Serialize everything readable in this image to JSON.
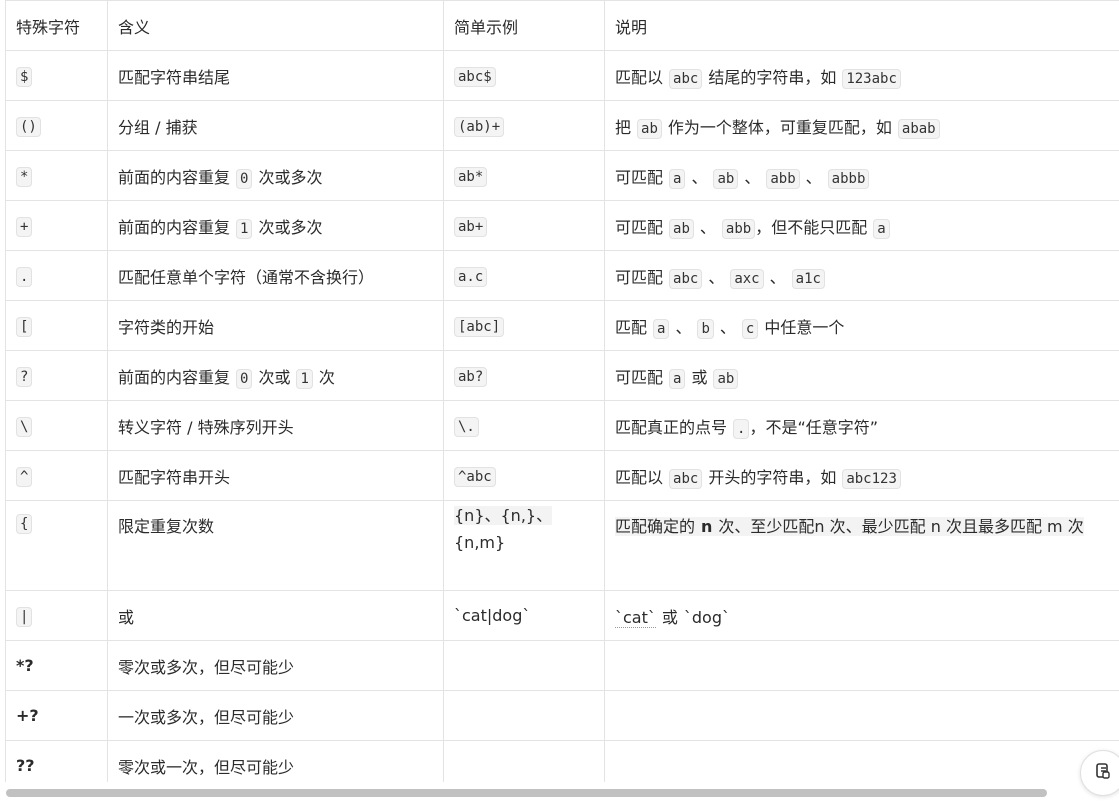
{
  "table": {
    "headers": [
      "特殊字符",
      "含义",
      "简单示例",
      "说明"
    ],
    "rows": [
      {
        "char": "$",
        "meaning": "匹配字符串结尾",
        "example": "abc$",
        "desc": {
          "t1": "匹配以",
          "c1": "abc",
          "t2": "结尾的字符串，如",
          "c2": "123abc"
        }
      },
      {
        "char": "()",
        "meaning": "分组 / 捕获",
        "example": "(ab)+",
        "desc": {
          "t1": "把",
          "c1": "ab",
          "t2": "作为一个整体，可重复匹配，如",
          "c2": "abab"
        }
      },
      {
        "char": "*",
        "meaning": {
          "t1": "前面的内容重复",
          "c1": "0",
          "t2": "次或多次"
        },
        "example": "ab*",
        "desc": {
          "t1": "可匹配",
          "c1": "a",
          "s1": "、",
          "c2": "ab",
          "s2": "、",
          "c3": "abb",
          "s3": "、",
          "c4": "abbb"
        }
      },
      {
        "char": "+",
        "meaning": {
          "t1": "前面的内容重复",
          "c1": "1",
          "t2": "次或多次"
        },
        "example": "ab+",
        "desc": {
          "t1": "可匹配",
          "c1": "ab",
          "s1": "、",
          "c2": "abb",
          "t2": "，但不能只匹配",
          "c3": "a"
        }
      },
      {
        "char": ".",
        "meaning": "匹配任意单个字符（通常不含换行）",
        "example": "a.c",
        "desc": {
          "t1": "可匹配",
          "c1": "abc",
          "s1": "、",
          "c2": "axc",
          "s2": "、",
          "c3": "a1c"
        }
      },
      {
        "char": "[",
        "meaning": "字符类的开始",
        "example": "[abc]",
        "desc": {
          "t1": "匹配",
          "c1": "a",
          "s1": "、",
          "c2": "b",
          "s2": "、",
          "c3": "c",
          "t2": "中任意一个"
        }
      },
      {
        "char": "?",
        "meaning": {
          "t1": "前面的内容重复",
          "c1": "0",
          "t2": "次或",
          "c2": "1",
          "t3": "次"
        },
        "example": "ab?",
        "desc": {
          "t1": "可匹配",
          "c1": "a",
          "t2": "或",
          "c2": "ab"
        }
      },
      {
        "char": "\\",
        "meaning": "转义字符 / 特殊序列开头",
        "example": "\\.",
        "desc": {
          "t1": "匹配真正的点号",
          "c1": ".",
          "t2": "，不是“任意字符”"
        }
      },
      {
        "char": "^",
        "meaning": "匹配字符串开头",
        "example": "^abc",
        "desc": {
          "t1": "匹配以",
          "c1": "abc",
          "t2": "开头的字符串，如",
          "c2": "abc123"
        }
      },
      {
        "char": "{",
        "meaning": "限定重复次数",
        "example": {
          "line1": "{n}、{n,}、",
          "line2": "{n,m}"
        },
        "desc": {
          "t1": "匹配确定的",
          "b1": "n",
          "t2": "次、至少匹配n 次、最少匹配 n 次且最多匹配 m 次"
        }
      },
      {
        "char": "|",
        "meaning": "或",
        "example": "`cat|dog`",
        "desc": {
          "q1": "`cat`",
          "t1": "或",
          "q2": "`dog`"
        }
      },
      {
        "char": "*?",
        "meaning": "零次或多次，但尽可能少",
        "example": "",
        "desc": ""
      },
      {
        "char": "+?",
        "meaning": "一次或多次，但尽可能少",
        "example": "",
        "desc": ""
      },
      {
        "char": "??",
        "meaning": "零次或一次，但尽可能少",
        "example": "",
        "desc": ""
      }
    ]
  },
  "icons": {
    "float_button": "copy-icon"
  },
  "colors": {
    "border": "#e3e3e3",
    "code_bg": "#f4f4f4",
    "scrollbar": "#c1c1c1"
  }
}
